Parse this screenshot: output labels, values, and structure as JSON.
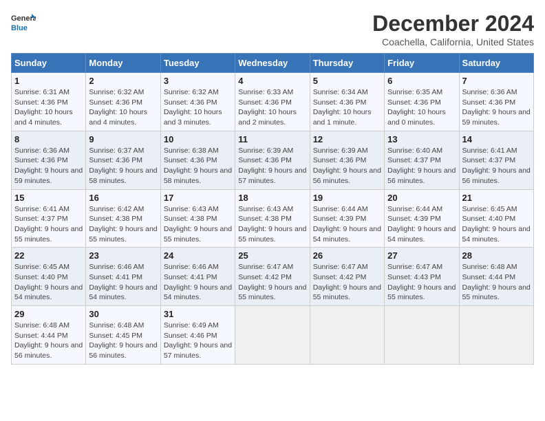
{
  "header": {
    "logo_general": "General",
    "logo_blue": "Blue",
    "main_title": "December 2024",
    "sub_title": "Coachella, California, United States"
  },
  "calendar": {
    "days_of_week": [
      "Sunday",
      "Monday",
      "Tuesday",
      "Wednesday",
      "Thursday",
      "Friday",
      "Saturday"
    ],
    "weeks": [
      [
        {
          "day": "1",
          "sunrise": "6:31 AM",
          "sunset": "4:36 PM",
          "daylight": "10 hours and 4 minutes."
        },
        {
          "day": "2",
          "sunrise": "6:32 AM",
          "sunset": "4:36 PM",
          "daylight": "10 hours and 4 minutes."
        },
        {
          "day": "3",
          "sunrise": "6:32 AM",
          "sunset": "4:36 PM",
          "daylight": "10 hours and 3 minutes."
        },
        {
          "day": "4",
          "sunrise": "6:33 AM",
          "sunset": "4:36 PM",
          "daylight": "10 hours and 2 minutes."
        },
        {
          "day": "5",
          "sunrise": "6:34 AM",
          "sunset": "4:36 PM",
          "daylight": "10 hours and 1 minute."
        },
        {
          "day": "6",
          "sunrise": "6:35 AM",
          "sunset": "4:36 PM",
          "daylight": "10 hours and 0 minutes."
        },
        {
          "day": "7",
          "sunrise": "6:36 AM",
          "sunset": "4:36 PM",
          "daylight": "9 hours and 59 minutes."
        }
      ],
      [
        {
          "day": "8",
          "sunrise": "6:36 AM",
          "sunset": "4:36 PM",
          "daylight": "9 hours and 59 minutes."
        },
        {
          "day": "9",
          "sunrise": "6:37 AM",
          "sunset": "4:36 PM",
          "daylight": "9 hours and 58 minutes."
        },
        {
          "day": "10",
          "sunrise": "6:38 AM",
          "sunset": "4:36 PM",
          "daylight": "9 hours and 58 minutes."
        },
        {
          "day": "11",
          "sunrise": "6:39 AM",
          "sunset": "4:36 PM",
          "daylight": "9 hours and 57 minutes."
        },
        {
          "day": "12",
          "sunrise": "6:39 AM",
          "sunset": "4:36 PM",
          "daylight": "9 hours and 56 minutes."
        },
        {
          "day": "13",
          "sunrise": "6:40 AM",
          "sunset": "4:37 PM",
          "daylight": "9 hours and 56 minutes."
        },
        {
          "day": "14",
          "sunrise": "6:41 AM",
          "sunset": "4:37 PM",
          "daylight": "9 hours and 56 minutes."
        }
      ],
      [
        {
          "day": "15",
          "sunrise": "6:41 AM",
          "sunset": "4:37 PM",
          "daylight": "9 hours and 55 minutes."
        },
        {
          "day": "16",
          "sunrise": "6:42 AM",
          "sunset": "4:38 PM",
          "daylight": "9 hours and 55 minutes."
        },
        {
          "day": "17",
          "sunrise": "6:43 AM",
          "sunset": "4:38 PM",
          "daylight": "9 hours and 55 minutes."
        },
        {
          "day": "18",
          "sunrise": "6:43 AM",
          "sunset": "4:38 PM",
          "daylight": "9 hours and 55 minutes."
        },
        {
          "day": "19",
          "sunrise": "6:44 AM",
          "sunset": "4:39 PM",
          "daylight": "9 hours and 54 minutes."
        },
        {
          "day": "20",
          "sunrise": "6:44 AM",
          "sunset": "4:39 PM",
          "daylight": "9 hours and 54 minutes."
        },
        {
          "day": "21",
          "sunrise": "6:45 AM",
          "sunset": "4:40 PM",
          "daylight": "9 hours and 54 minutes."
        }
      ],
      [
        {
          "day": "22",
          "sunrise": "6:45 AM",
          "sunset": "4:40 PM",
          "daylight": "9 hours and 54 minutes."
        },
        {
          "day": "23",
          "sunrise": "6:46 AM",
          "sunset": "4:41 PM",
          "daylight": "9 hours and 54 minutes."
        },
        {
          "day": "24",
          "sunrise": "6:46 AM",
          "sunset": "4:41 PM",
          "daylight": "9 hours and 54 minutes."
        },
        {
          "day": "25",
          "sunrise": "6:47 AM",
          "sunset": "4:42 PM",
          "daylight": "9 hours and 55 minutes."
        },
        {
          "day": "26",
          "sunrise": "6:47 AM",
          "sunset": "4:42 PM",
          "daylight": "9 hours and 55 minutes."
        },
        {
          "day": "27",
          "sunrise": "6:47 AM",
          "sunset": "4:43 PM",
          "daylight": "9 hours and 55 minutes."
        },
        {
          "day": "28",
          "sunrise": "6:48 AM",
          "sunset": "4:44 PM",
          "daylight": "9 hours and 55 minutes."
        }
      ],
      [
        {
          "day": "29",
          "sunrise": "6:48 AM",
          "sunset": "4:44 PM",
          "daylight": "9 hours and 56 minutes."
        },
        {
          "day": "30",
          "sunrise": "6:48 AM",
          "sunset": "4:45 PM",
          "daylight": "9 hours and 56 minutes."
        },
        {
          "day": "31",
          "sunrise": "6:49 AM",
          "sunset": "4:46 PM",
          "daylight": "9 hours and 57 minutes."
        },
        null,
        null,
        null,
        null
      ]
    ]
  }
}
